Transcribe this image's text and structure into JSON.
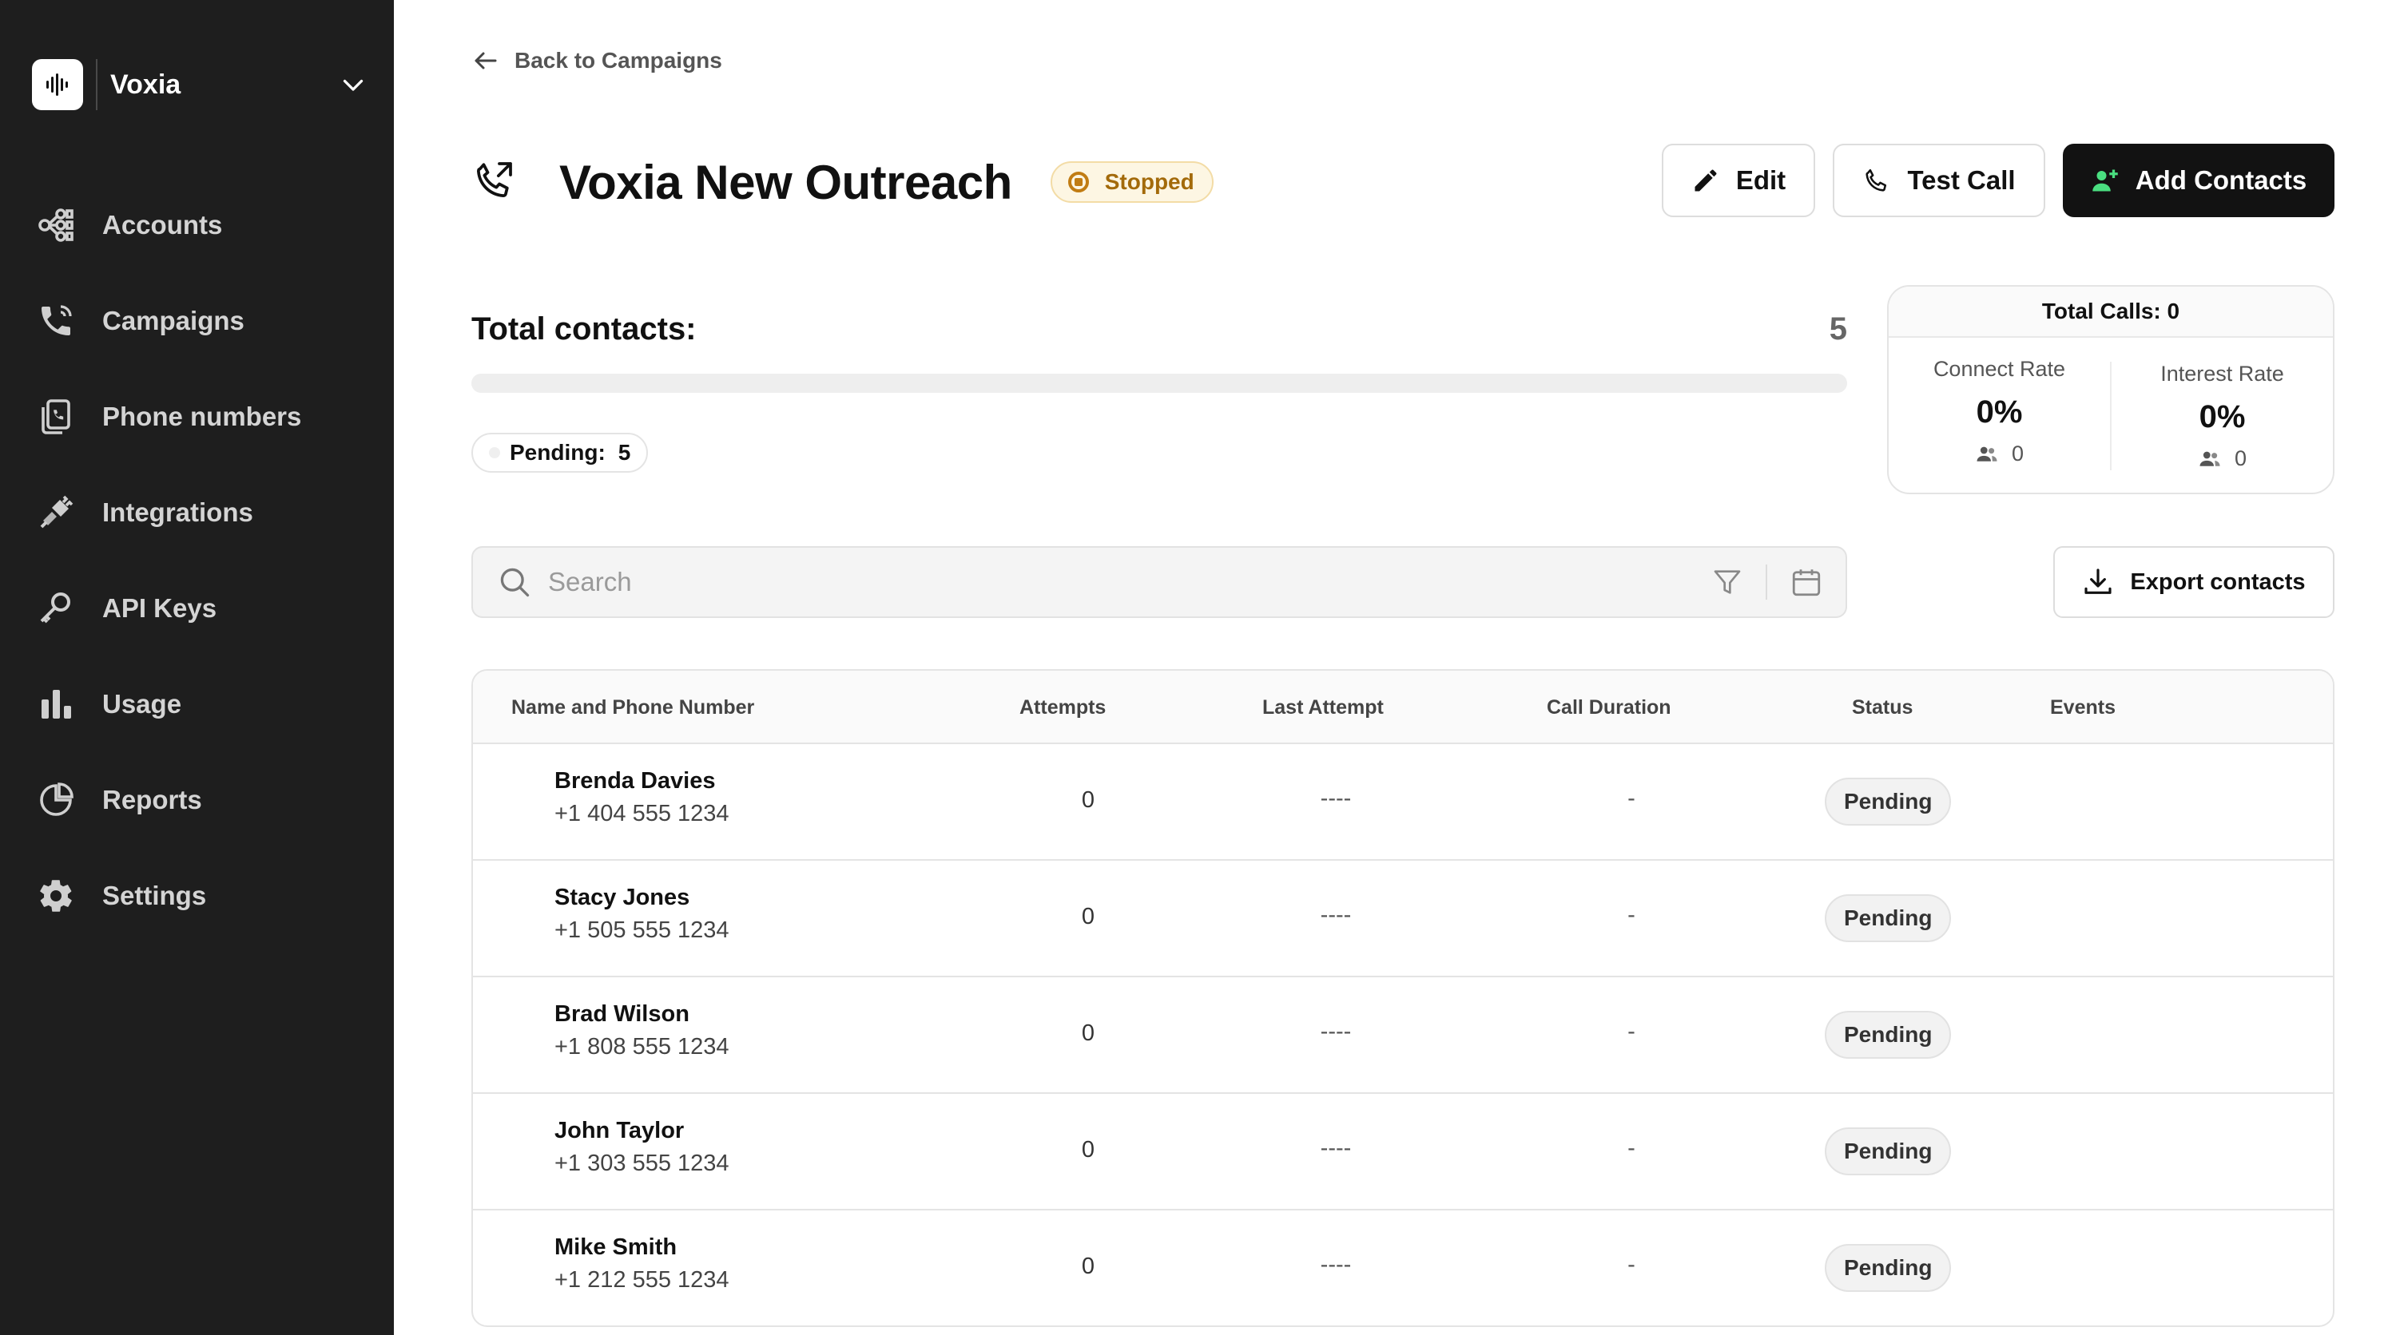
{
  "brand": {
    "name": "Voxia"
  },
  "sidebar": {
    "items": [
      {
        "label": "Accounts",
        "icon": "accounts-icon"
      },
      {
        "label": "Campaigns",
        "icon": "phone-icon"
      },
      {
        "label": "Phone numbers",
        "icon": "phone-numbers-icon"
      },
      {
        "label": "Integrations",
        "icon": "plug-icon"
      },
      {
        "label": "API Keys",
        "icon": "key-icon"
      },
      {
        "label": "Usage",
        "icon": "bar-chart-icon"
      },
      {
        "label": "Reports",
        "icon": "pie-chart-icon"
      },
      {
        "label": "Settings",
        "icon": "gear-icon"
      }
    ]
  },
  "header": {
    "back_label": "Back to Campaigns",
    "title": "Voxia New Outreach",
    "status": "Stopped",
    "edit_label": "Edit",
    "test_call_label": "Test Call",
    "add_contacts_label": "Add Contacts"
  },
  "summary": {
    "total_contacts_label": "Total contacts:",
    "total_contacts_value": "5",
    "progress_fraction": 0.0,
    "pending_label": "Pending:",
    "pending_count": "5"
  },
  "calls": {
    "title": "Total Calls: 0",
    "connect_label": "Connect Rate",
    "connect_value": "0%",
    "connect_count": "0",
    "interest_label": "Interest Rate",
    "interest_value": "0%",
    "interest_count": "0"
  },
  "search": {
    "placeholder": "Search"
  },
  "export_label": "Export contacts",
  "table": {
    "headers": {
      "name": "Name and Phone Number",
      "attempts": "Attempts",
      "last_attempt": "Last Attempt",
      "duration": "Call Duration",
      "status": "Status",
      "events": "Events"
    },
    "rows": [
      {
        "name": "Brenda Davies",
        "phone": "+1 404 555 1234",
        "attempts": "0",
        "last_attempt": "----",
        "duration": "-",
        "status": "Pending"
      },
      {
        "name": "Stacy Jones",
        "phone": "+1 505 555 1234",
        "attempts": "0",
        "last_attempt": "----",
        "duration": "-",
        "status": "Pending"
      },
      {
        "name": "Brad Wilson",
        "phone": "+1 808 555 1234",
        "attempts": "0",
        "last_attempt": "----",
        "duration": "-",
        "status": "Pending"
      },
      {
        "name": "John Taylor",
        "phone": "+1 303 555 1234",
        "attempts": "0",
        "last_attempt": "----",
        "duration": "-",
        "status": "Pending"
      },
      {
        "name": "Mike Smith",
        "phone": "+1 212 555 1234",
        "attempts": "0",
        "last_attempt": "----",
        "duration": "-",
        "status": "Pending"
      }
    ]
  },
  "colors": {
    "sidebar_bg": "#1e1e1e",
    "primary_button": "#121212",
    "status_stopped": "#c17c13",
    "add_contact_icon": "#4ade80"
  }
}
